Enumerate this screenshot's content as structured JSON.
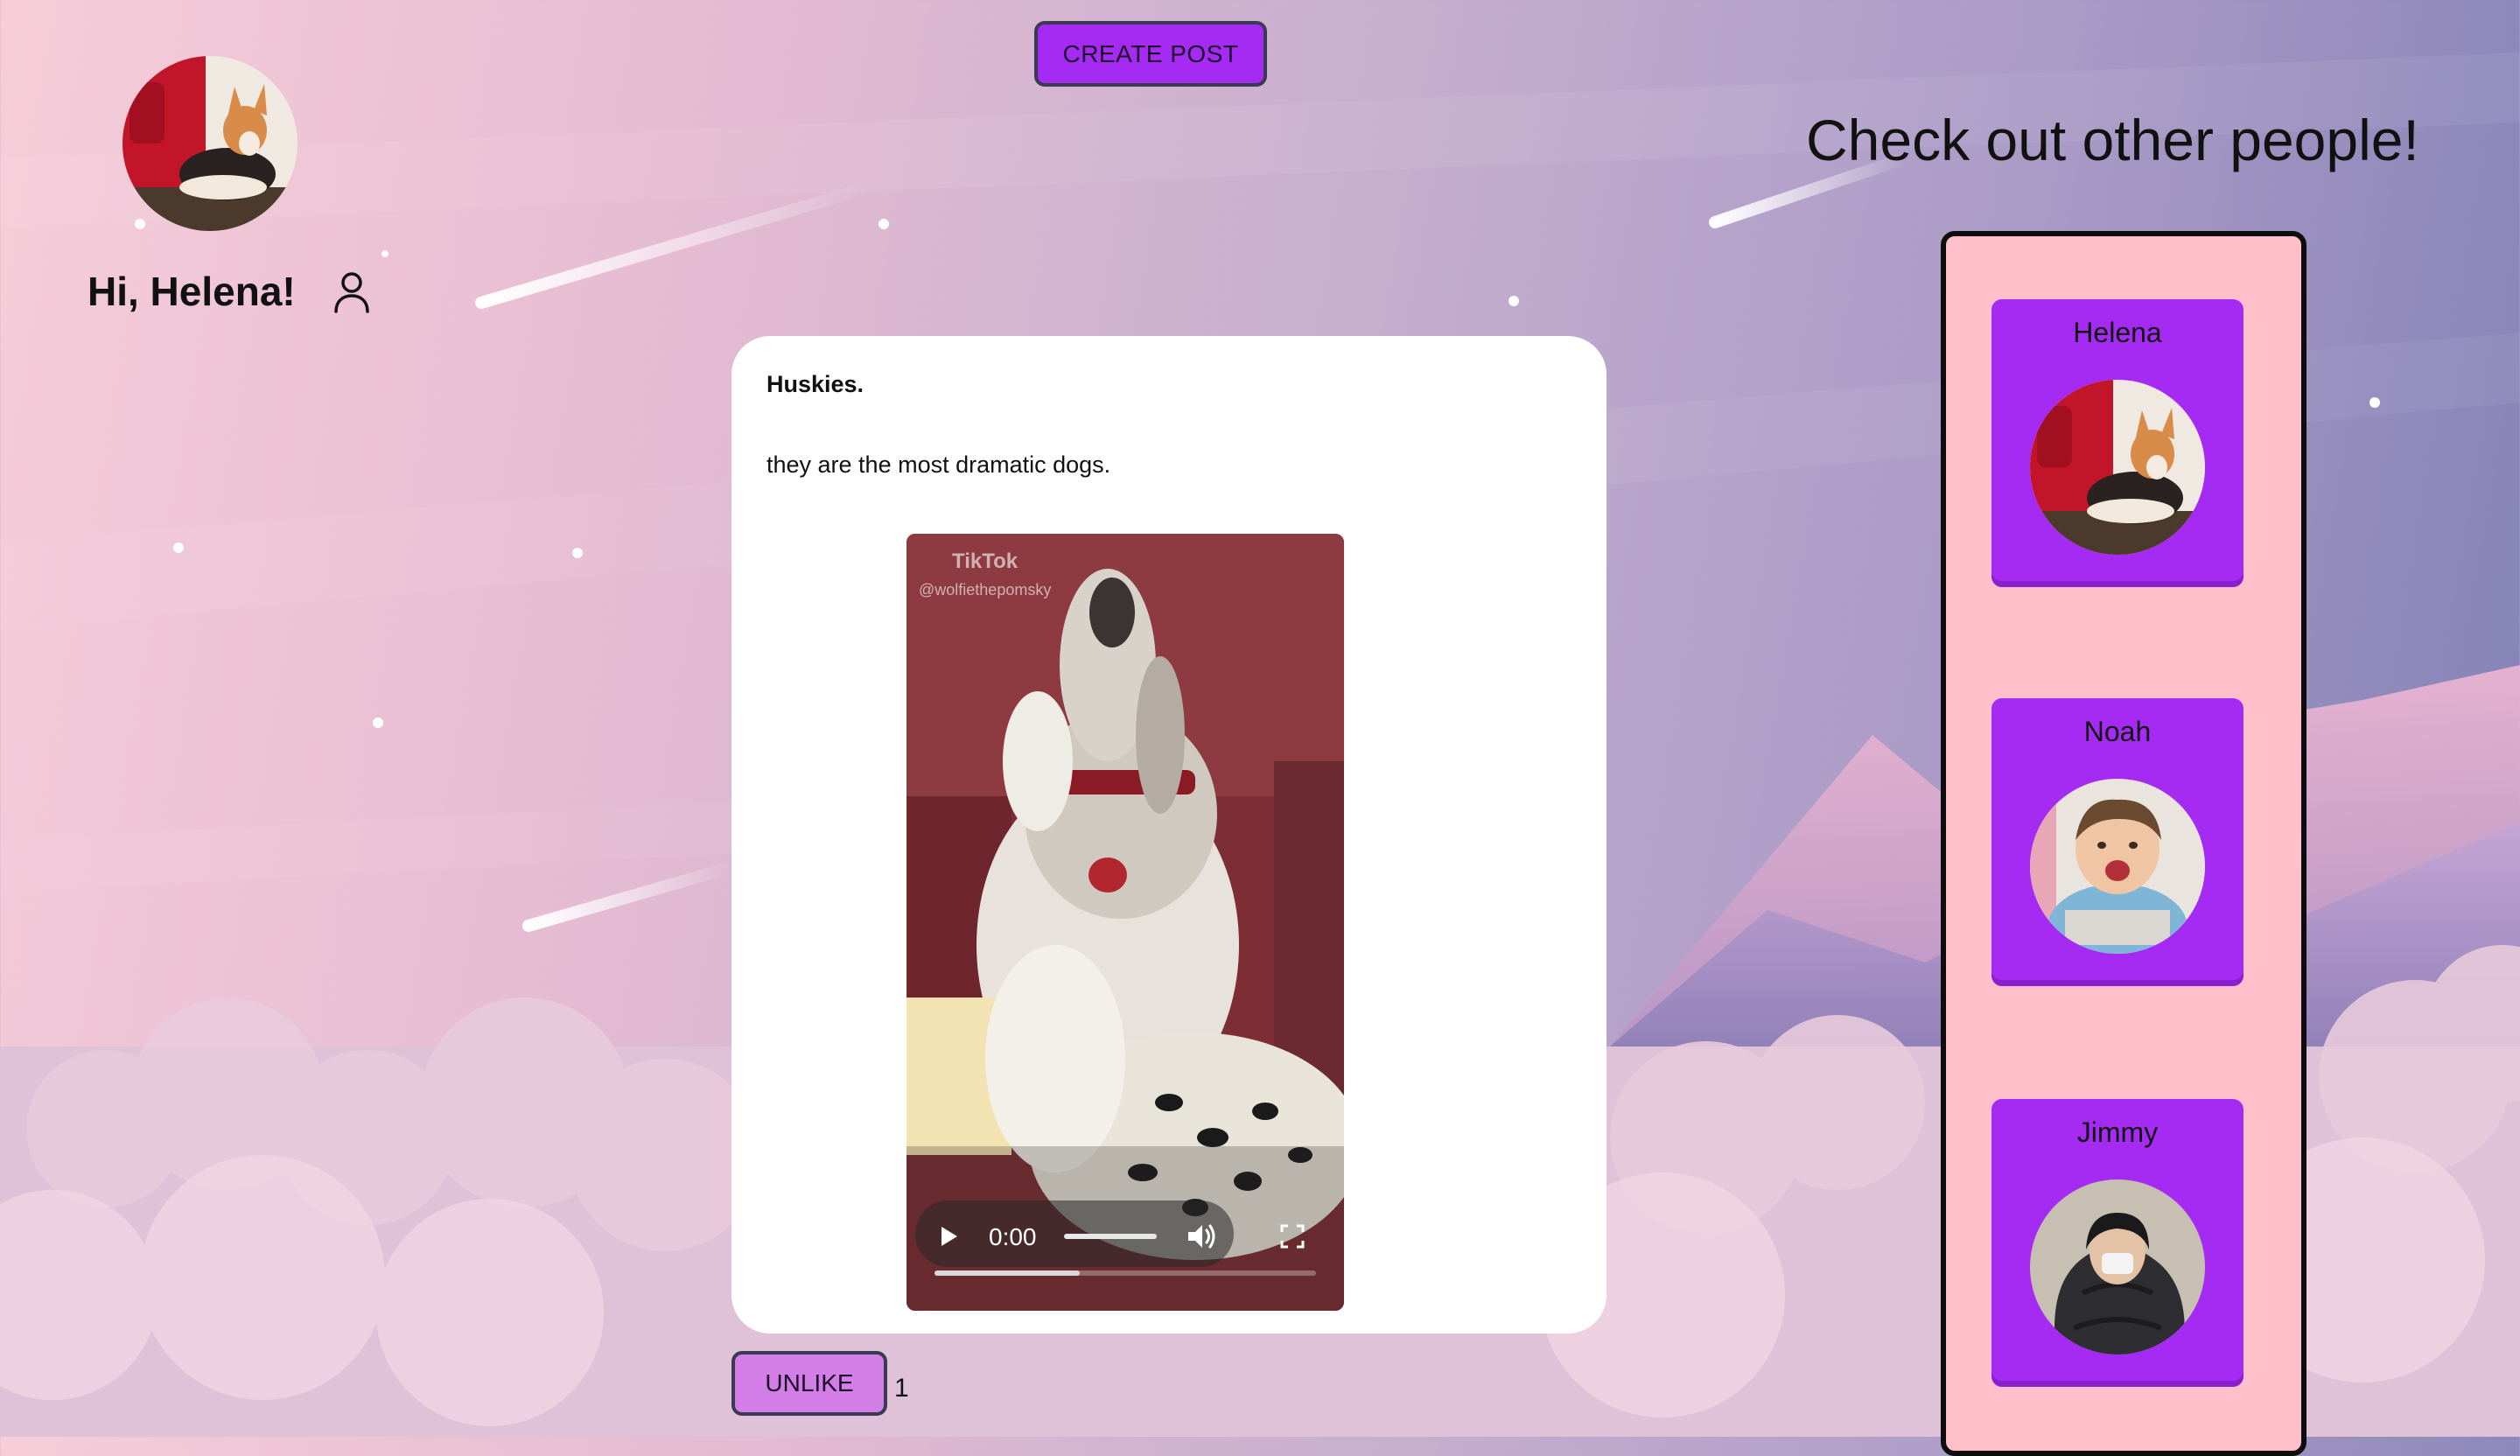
{
  "header": {
    "create_post_label": "CREATE POST"
  },
  "profile": {
    "greeting": "Hi, Helena!",
    "avatar_icon": "corgi-photo",
    "profile_icon": "person-icon"
  },
  "post": {
    "title": "Huskies.",
    "body": "they are the most dramatic dogs.",
    "video": {
      "watermark": "TikTok",
      "handle": "@wolfiethepomsky",
      "current_time": "0:00",
      "progress": 0.38,
      "volume": 1.0
    },
    "unlike_label": "UNLIKE",
    "like_count": "1"
  },
  "people": {
    "heading": "Check out other people!",
    "items": [
      {
        "name": "Helena",
        "avatar": "corgi-photo"
      },
      {
        "name": "Noah",
        "avatar": "laughing-child-photo"
      },
      {
        "name": "Jimmy",
        "avatar": "person-in-blanket-photo"
      }
    ]
  },
  "colors": {
    "accent_purple": "#a52bf2",
    "unlike_pink": "#d27ee6",
    "panel_pink": "#ffbfcb",
    "card_white": "#ffffff"
  }
}
